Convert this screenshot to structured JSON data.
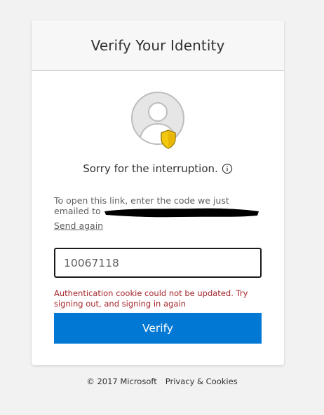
{
  "header": {
    "title": "Verify Your Identity"
  },
  "profile": {
    "avatar_icon": "user-avatar-icon",
    "badge_icon": "shield-badge-icon",
    "badge_color": "#f2c811"
  },
  "message": {
    "sorry": "Sorry for the interruption.",
    "info_icon": "info-icon",
    "instructions": "To open this link, enter the code we just emailed to",
    "send_again": "Send again"
  },
  "code_input": {
    "value": "10067118"
  },
  "error": {
    "text": "Authentication cookie could not be updated. Try signing out, and signing in again",
    "color": "#a4262c"
  },
  "verify_button": {
    "label": "Verify",
    "color": "#0078d4"
  },
  "footer": {
    "copyright": "© 2017 Microsoft",
    "privacy": "Privacy & Cookies"
  }
}
